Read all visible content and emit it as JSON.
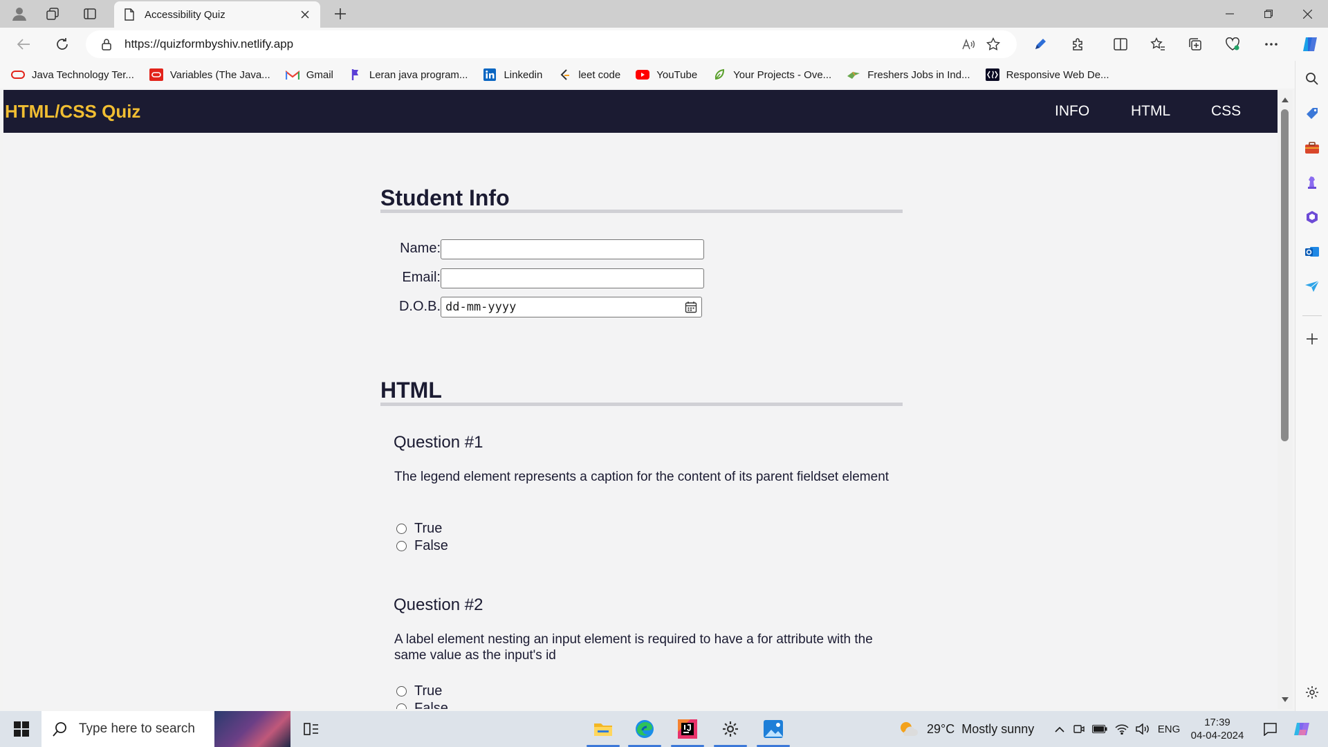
{
  "browser": {
    "tab_title": "Accessibility Quiz",
    "url": "https://quizformbyshiv.netlify.app",
    "bookmarks": [
      {
        "label": "Java Technology Ter...",
        "icon": "oracle-icon",
        "color": "#e2231a"
      },
      {
        "label": "Variables (The Java...",
        "icon": "oracle-box-icon",
        "color": "#e2231a"
      },
      {
        "label": "Gmail",
        "icon": "gmail-icon",
        "color": "#ea4335"
      },
      {
        "label": "Leran java program...",
        "icon": "flag-icon",
        "color": "#5b3fd6"
      },
      {
        "label": "Linkedin",
        "icon": "linkedin-icon",
        "color": "#0a66c2"
      },
      {
        "label": "leet code",
        "icon": "leetcode-icon",
        "color": "#333333"
      },
      {
        "label": "YouTube",
        "icon": "youtube-icon",
        "color": "#ff0000"
      },
      {
        "label": "Your Projects - Ove...",
        "icon": "leaf-icon",
        "color": "#5aa02c"
      },
      {
        "label": "Freshers Jobs in Ind...",
        "icon": "bird-icon",
        "color": "#6aa84f"
      },
      {
        "label": "Responsive Web De...",
        "icon": "freecodecamp-icon",
        "color": "#0a0a23"
      }
    ]
  },
  "page": {
    "logo": "HTML/CSS Quiz",
    "nav": [
      "INFO",
      "HTML",
      "CSS"
    ],
    "student_info": {
      "heading": "Student Info",
      "name_label": "Name:",
      "email_label": "Email:",
      "dob_label": "D.O.B.",
      "dob_placeholder": "dd-mm-yyyy"
    },
    "html_section": {
      "heading": "HTML",
      "questions": [
        {
          "title": "Question #1",
          "text": "The legend element represents a caption for the content of its parent fieldset element",
          "options": [
            "True",
            "False"
          ]
        },
        {
          "title": "Question #2",
          "text": "A label element nesting an input element is required to have a for attribute with the same value as the input's id",
          "options": [
            "True",
            "False"
          ]
        }
      ]
    }
  },
  "taskbar": {
    "search_placeholder": "Type here to search",
    "weather": "29°C  Mostly sunny",
    "language": "ENG",
    "time": "17:39",
    "date": "04-04-2024"
  },
  "colors": {
    "nav_bg": "#1b1b32",
    "logo": "#f1be32",
    "accent": "#3b78d8"
  }
}
